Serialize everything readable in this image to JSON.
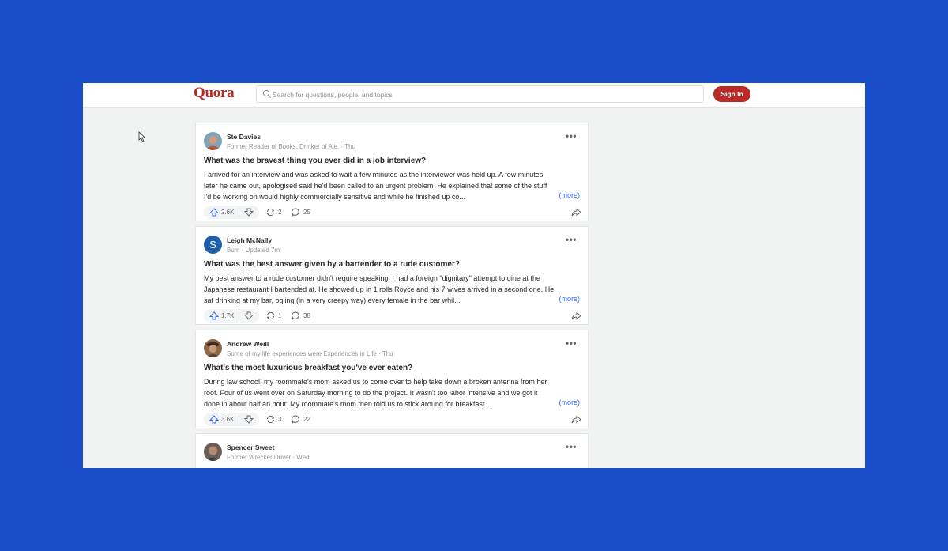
{
  "header": {
    "logo": "Quora",
    "search_placeholder": "Search for questions, people, and topics",
    "signin_label": "Sign In"
  },
  "feed": [
    {
      "author": "Ste Davies",
      "credential": "Former Reader of Books, Drinker of Ale. · Thu",
      "question": "What was the bravest thing you ever did in a job interview?",
      "excerpt": [
        "I arrived for an interview and was asked to wait a few minutes as the interviewer was held up. A few minutes",
        "later he came out, apologised said he'd been called to an urgent problem. He explained that some of the stuff",
        "I'd be working on would highly commercially sensitive and while he finished up co..."
      ],
      "more": "(more)",
      "upvotes": "2.6K",
      "shares": "2",
      "comments": "25"
    },
    {
      "author": "Leigh McNally",
      "avatar_letter": "S",
      "credential": "Bum · Updated 7m",
      "question": "What was the best answer given by a bartender to a rude customer?",
      "excerpt": [
        "My best answer to a rude customer didn't require speaking. I had a foreign \"dignitary\" attempt to dine at the",
        "Japanese restaurant I bartended at. He showed up in 1 rolls Royce and his 7 wives arrived in a second one. He",
        "sat drinking at my bar, ogling (in a very creepy way) every female in the bar whil..."
      ],
      "more": "(more)",
      "upvotes": "1.7K",
      "shares": "1",
      "comments": "38"
    },
    {
      "author": "Andrew Weill",
      "credential": "Some of my life experiences were Experiences in Life · Thu",
      "question": "What's the most luxurious breakfast you've ever eaten?",
      "excerpt": [
        "During law school, my roommate's mom asked us to come over to help take down a broken antenna from her",
        "roof. Four of us went over on Saturday morning to do the project. It wasn't too labor intensive and we got it",
        "done in about half an hour. My roommate's mom then told us to stick around for breakfast..."
      ],
      "more": "(more)",
      "upvotes": "3.6K",
      "shares": "3",
      "comments": "22"
    },
    {
      "author": "Spencer Sweet",
      "credential": "Former Wrecker Driver · Wed"
    }
  ],
  "colors": {
    "brand": "#b92b27",
    "link": "#2e69ff",
    "backdrop": "#1a4cc8"
  }
}
